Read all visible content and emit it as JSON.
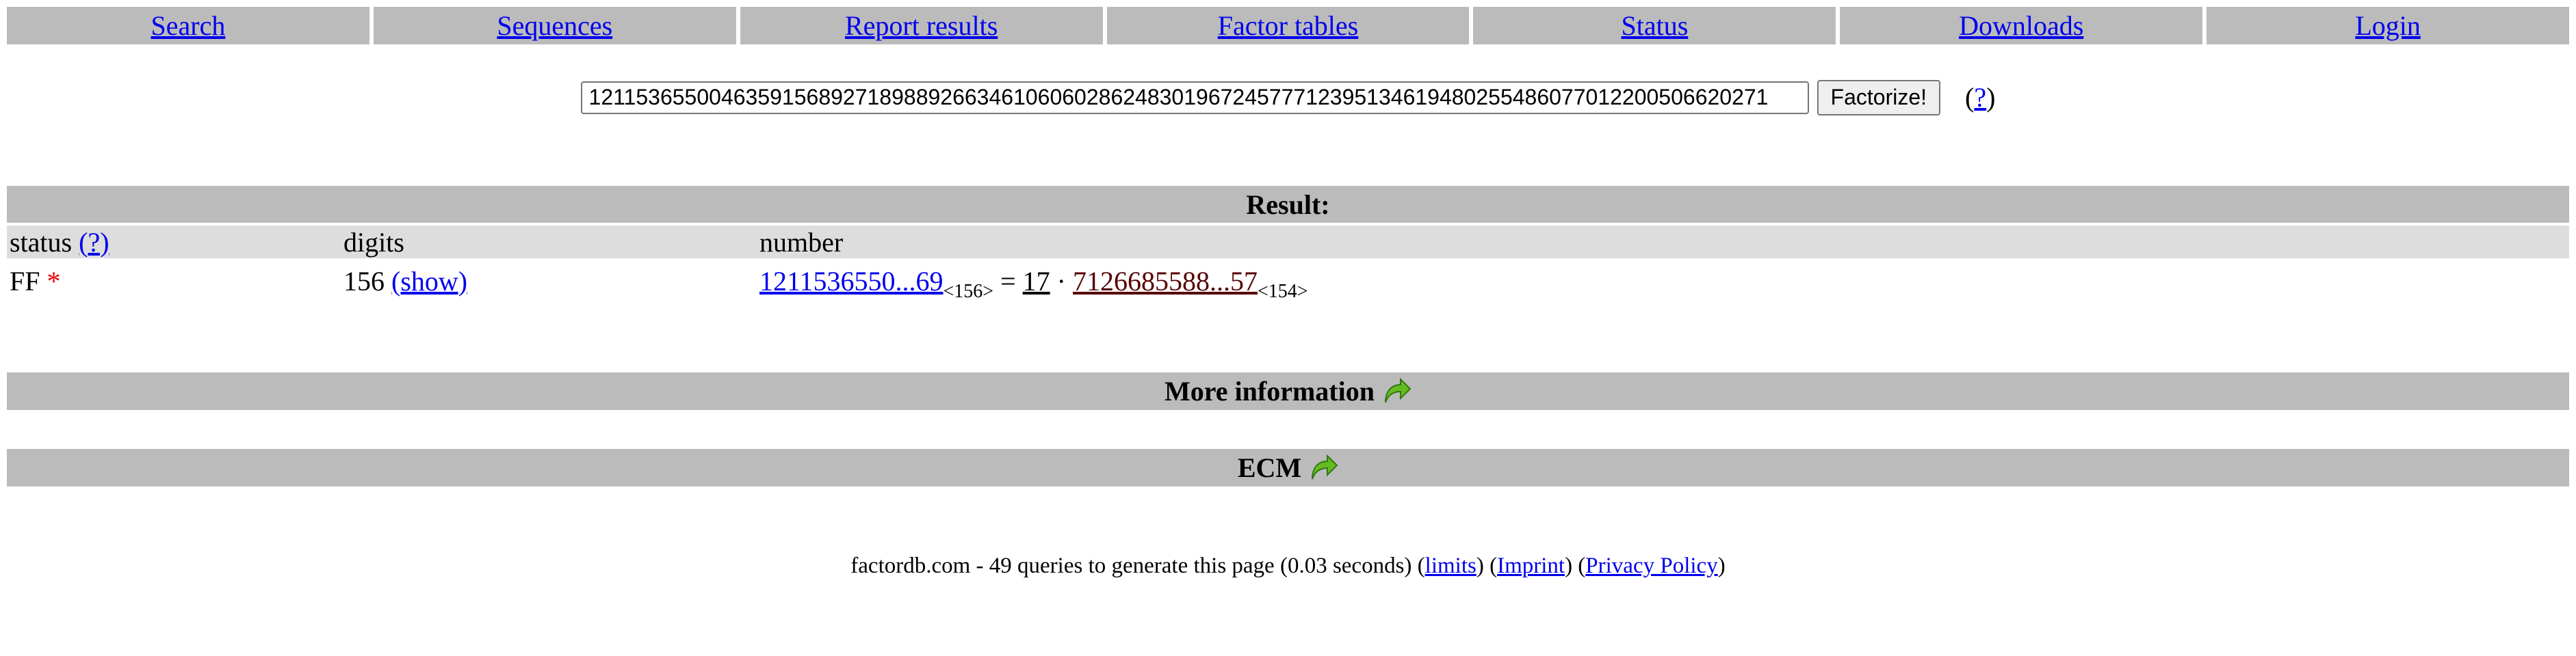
{
  "nav": {
    "items": [
      {
        "label": "Search"
      },
      {
        "label": "Sequences"
      },
      {
        "label": "Report results"
      },
      {
        "label": "Factor tables"
      },
      {
        "label": "Status"
      },
      {
        "label": "Downloads"
      },
      {
        "label": "Login"
      }
    ]
  },
  "search": {
    "value": "1211536550046359156892718988926634610606028624830196724577712395134619480255486077012200506620271",
    "button_label": "Factorize!",
    "help_label": "?"
  },
  "result": {
    "title": "Result:",
    "headers": {
      "status": "status",
      "status_help": "(?)",
      "digits": "digits",
      "number": "number"
    },
    "row": {
      "status": "FF",
      "status_mark": "*",
      "digits": "156",
      "show_label": "(show)",
      "number_short": "1211536550...69",
      "number_digits": "<156>",
      "equals": "=",
      "factor1": "17",
      "dot": "·",
      "factor2": "7126685588...57",
      "factor2_digits": "<154>"
    }
  },
  "sections": {
    "more_info": "More information",
    "ecm": "ECM"
  },
  "footer": {
    "text": "factordb.com - 49 queries to generate this page (0.03 seconds) (",
    "limits": "limits",
    "sep1": ") (",
    "imprint": "Imprint",
    "sep2": ") (",
    "privacy": "Privacy Policy",
    "end": ")"
  },
  "colors": {
    "bar": "#bbbbbb",
    "header_row": "#dddddd",
    "link": "#0000ee",
    "status_mark": "#ee0000",
    "arrow": "#66bb22"
  }
}
